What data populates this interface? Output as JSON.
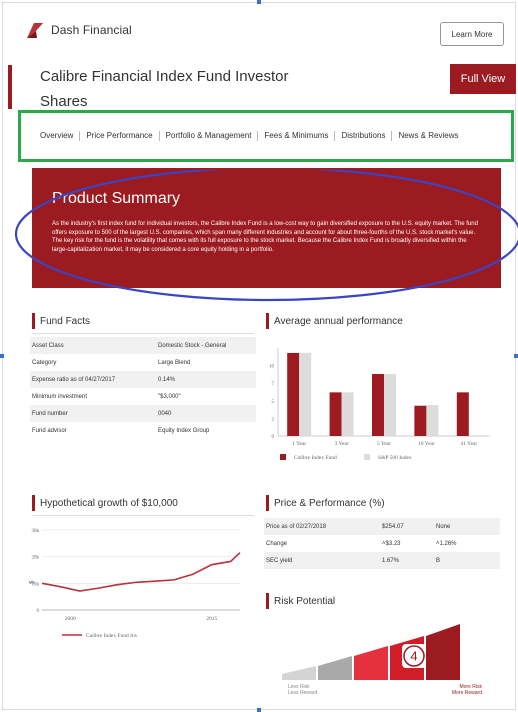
{
  "brand": {
    "name": "Dash Financial",
    "color": "#9b1b20"
  },
  "header": {
    "learn_more_label": "Learn More",
    "full_view_label": "Full View"
  },
  "fund": {
    "title": "Calibre Financial Index Fund Investor Shares"
  },
  "nav": {
    "items": [
      "Overview",
      "Price Performance",
      "Portfolio & Management",
      "Fees & Minimums",
      "Distributions",
      "News & Reviews"
    ]
  },
  "summary": {
    "title": "Product Summary",
    "text": "As the industry's first index fund for individual investors, the Calibre Index Fund is a low-cost way to gain diversified exposure to the U.S. equity market. The fund offers exposure to 500 of the largest U.S. companies, which span many different industries and account for about three-fourths of the U.S. stock market's value. The key risk for the fund is the volatility that comes with its full exposure to the stock market. Because the Calibre Index Fund is broadly diversified within the large-capitalization market, it may be considered a core equity holding in a portfolio."
  },
  "fund_facts": {
    "title": "Fund Facts",
    "rows": [
      [
        "Asset Class",
        "Domestic Stock - General"
      ],
      [
        "Category",
        "Large Blend"
      ],
      [
        "Expense ratio as of 04/27/2017",
        "0.14%"
      ],
      [
        "Minimum investment",
        "\"$3,000\""
      ],
      [
        "Fund number",
        "0040"
      ],
      [
        "Fund advisor",
        "Equity Index Group"
      ]
    ]
  },
  "price_performance": {
    "title": "Price & Performance (%)",
    "rows": [
      [
        "Price as of 02/27/2018",
        "$254.07",
        "None"
      ],
      [
        "Change",
        "˄$3.23",
        "˄1.26%"
      ],
      [
        "SEC yield",
        "1.67%",
        "B"
      ]
    ]
  },
  "risk": {
    "title": "Risk Potential",
    "level": 4,
    "of": 5,
    "low_label_1": "Less Risk",
    "low_label_2": "Less Reward",
    "high_label_1": "More Risk",
    "high_label_2": "More Reward"
  },
  "chart_data": [
    {
      "type": "bar",
      "title": "Average annual performance",
      "categories": [
        "1 Year",
        "3 Year",
        "5 Year",
        "10 Year",
        "41 Year"
      ],
      "series": [
        {
          "name": "Calibre Index Fund",
          "values": [
            11.8,
            6.2,
            8.8,
            4.3,
            6.2
          ],
          "color": "#9b1b20"
        },
        {
          "name": "S&P 500 Index",
          "values": [
            11.8,
            6.2,
            8.8,
            4.4,
            null
          ],
          "color": "#dcdcdc"
        }
      ],
      "yticks": [
        0,
        2.5,
        5,
        7.5,
        10
      ],
      "ytick_labels": [
        "0",
        "2",
        "5",
        "7",
        "10"
      ],
      "ylim": [
        0,
        12.5
      ],
      "legend": "bottom"
    },
    {
      "type": "line",
      "title": "Hypothetical growth of $10,000",
      "ylabel": "$",
      "x": [
        1997,
        1999,
        2001,
        2003,
        2005,
        2007,
        2009,
        2011,
        2013,
        2015,
        2017,
        2018
      ],
      "series": [
        {
          "name": "Calibre Index Fund Inv",
          "values": [
            10,
            8.7,
            7.1,
            8.2,
            9.5,
            10.4,
            10.8,
            11.3,
            13.4,
            17,
            18.2,
            21.5
          ],
          "color": "#b8323a"
        }
      ],
      "xticks": [
        2000,
        2015
      ],
      "yticks": [
        0,
        10,
        20,
        30
      ],
      "ytick_labels": [
        "0",
        "10k",
        "20k",
        "30k"
      ],
      "ylim": [
        0,
        30
      ],
      "legend": "bottom"
    }
  ]
}
